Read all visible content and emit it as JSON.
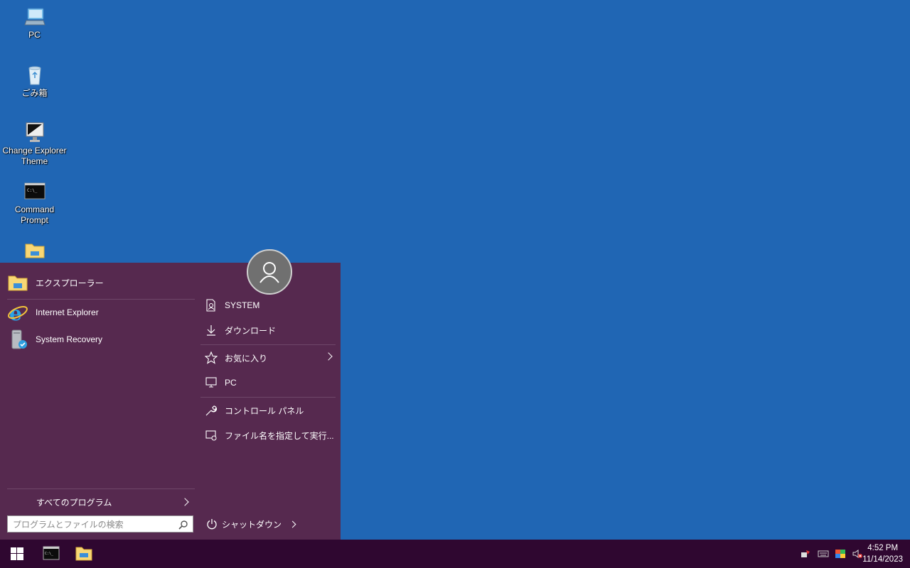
{
  "desktop": {
    "icons": [
      {
        "label": "PC",
        "icon": "computer-icon"
      },
      {
        "label": "ごみ箱",
        "icon": "recycle-bin-icon"
      },
      {
        "label": "Change Explorer Theme",
        "icon": "monitor-theme-icon"
      },
      {
        "label": "Command Prompt",
        "icon": "command-prompt-icon"
      },
      {
        "label": "",
        "icon": "folder-icon"
      }
    ]
  },
  "start_menu": {
    "pinned": [
      {
        "label": "エクスプローラー",
        "icon": "file-explorer-icon"
      },
      {
        "label": "Internet Explorer",
        "icon": "internet-explorer-icon"
      },
      {
        "label": "System Recovery",
        "icon": "system-recovery-icon"
      }
    ],
    "places": [
      {
        "label": "SYSTEM",
        "icon": "user-document-icon"
      },
      {
        "label": "ダウンロード",
        "icon": "download-icon"
      },
      {
        "label": "お気に入り",
        "icon": "star-icon",
        "has_submenu": true
      },
      {
        "label": "PC",
        "icon": "computer-icon"
      },
      {
        "label": "コントロール パネル",
        "icon": "wrench-icon"
      },
      {
        "label": "ファイル名を指定して実行...",
        "icon": "run-icon"
      }
    ],
    "all_programs": "すべてのプログラム",
    "search_placeholder": "プログラムとファイルの検索",
    "shutdown": "シャットダウン",
    "user_avatar": "user-avatar-icon"
  },
  "taskbar": {
    "start_icon": "windows-start-icon",
    "apps": [
      "command-prompt-icon",
      "file-explorer-icon"
    ],
    "tray": [
      "network-icon",
      "keyboard-icon",
      "color-icon",
      "volume-muted-icon"
    ],
    "time": "4:52 PM",
    "date": "11/14/2023"
  },
  "colors": {
    "desktop": "#2066b4",
    "start_menu": "#56294f",
    "taskbar": "#2f0730"
  }
}
